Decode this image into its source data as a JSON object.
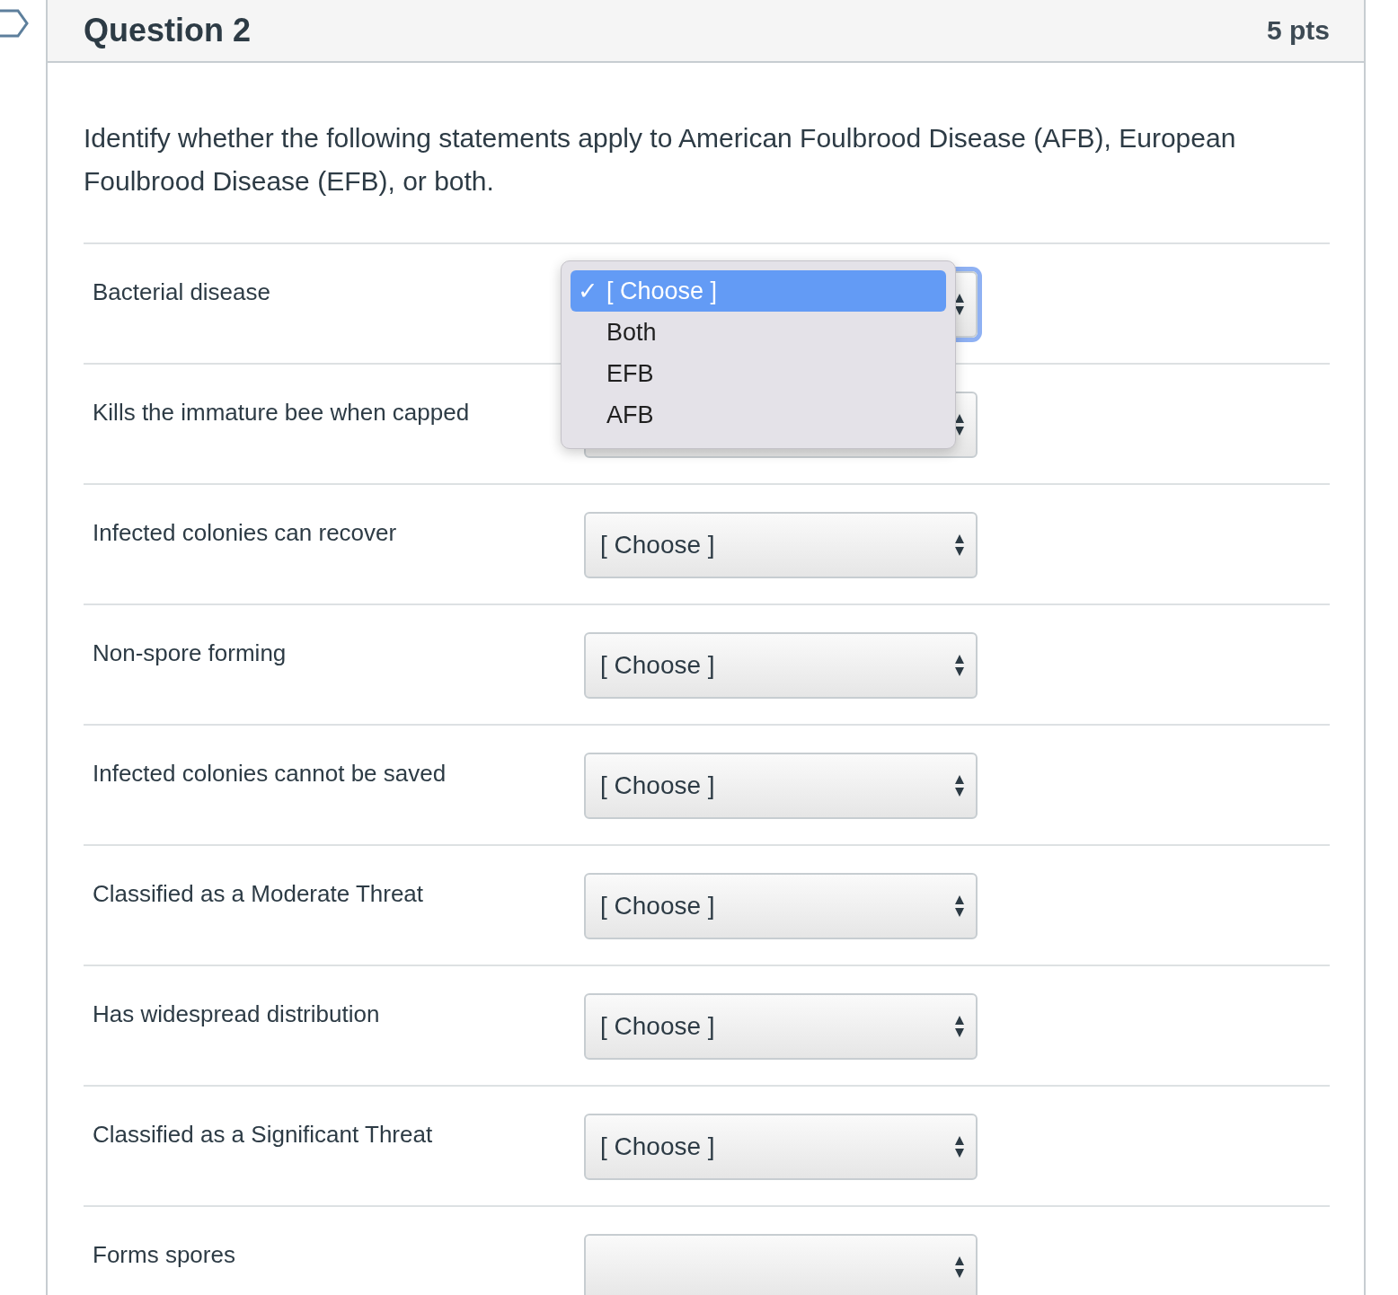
{
  "question": {
    "title": "Question 2",
    "points": "5 pts",
    "prompt": "Identify whether the following statements apply to American Foulbrood Disease (AFB), European Foulbrood Disease (EFB), or both."
  },
  "rows": [
    {
      "statement": "Bacterial disease",
      "select": {
        "focused": true
      }
    },
    {
      "statement": "Kills the immature bee when capped",
      "select": {
        "focused": false
      }
    },
    {
      "statement": "Infected colonies can recover",
      "select": {
        "focused": false,
        "value": "[ Choose ]"
      }
    },
    {
      "statement": "Non-spore forming",
      "select": {
        "focused": false,
        "value": "[ Choose ]"
      }
    },
    {
      "statement": "Infected colonies cannot be saved",
      "select": {
        "focused": false,
        "value": "[ Choose ]"
      }
    },
    {
      "statement": "Classified as a Moderate Threat",
      "select": {
        "focused": false,
        "value": "[ Choose ]"
      }
    },
    {
      "statement": "Has widespread distribution",
      "select": {
        "focused": false,
        "value": "[ Choose ]"
      }
    },
    {
      "statement": "Classified as a Significant Threat",
      "select": {
        "focused": false,
        "value": "[ Choose ]"
      }
    },
    {
      "statement": "Forms spores",
      "select": {
        "focused": false
      }
    }
  ],
  "open_menu": {
    "check_mark": "✓",
    "options": [
      {
        "label": "[ Choose ]",
        "selected": true
      },
      {
        "label": "Both",
        "selected": false
      },
      {
        "label": "EFB",
        "selected": false
      },
      {
        "label": "AFB",
        "selected": false
      }
    ]
  }
}
